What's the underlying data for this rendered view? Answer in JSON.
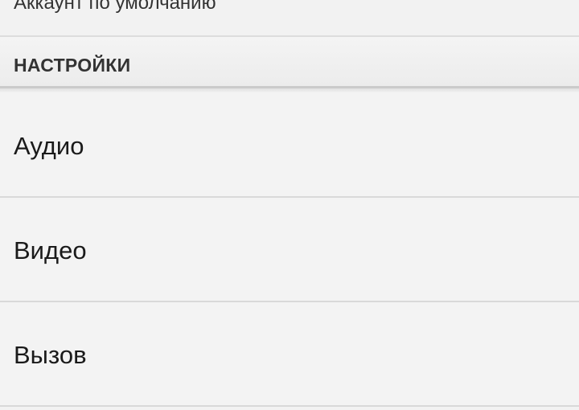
{
  "account": {
    "default_account_label": "Аккаунт по умолчанию"
  },
  "settings": {
    "header": "НАСТРОЙКИ",
    "items": [
      {
        "label": "Аудио"
      },
      {
        "label": "Видео"
      },
      {
        "label": "Вызов"
      }
    ]
  }
}
